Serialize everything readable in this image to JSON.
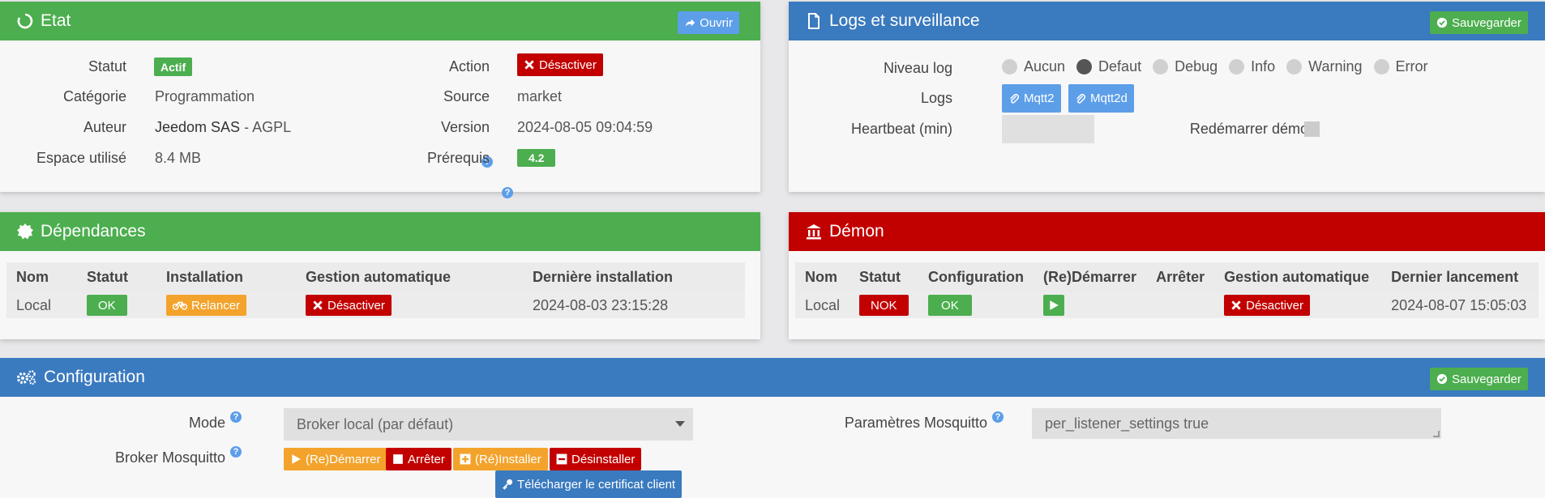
{
  "etat": {
    "title": "Etat",
    "open_label": "Ouvrir",
    "statut_label": "Statut",
    "statut_value": "Actif",
    "categorie_label": "Catégorie",
    "categorie_value": "Programmation",
    "auteur_label": "Auteur",
    "auteur_value": "Jeedom SAS",
    "auteur_license": " - AGPL",
    "espace_label": "Espace utilisé",
    "espace_value": "8.4 MB",
    "action_label": "Action",
    "action_button": "Désactiver",
    "source_label": "Source",
    "source_value": "market",
    "version_label": "Version",
    "version_value": "2024-08-05 09:04:59",
    "prerequis_label": "Prérequis",
    "prerequis_value": "4.2",
    "help_glyph": "?"
  },
  "logs": {
    "title": "Logs et surveillance",
    "save_label": "Sauvegarder",
    "niveau_label": "Niveau log",
    "levels": [
      "Aucun",
      "Defaut",
      "Debug",
      "Info",
      "Warning",
      "Error"
    ],
    "selected_level": "Defaut",
    "logs_label": "Logs",
    "log_buttons": [
      "Mqtt2",
      "Mqtt2d"
    ],
    "heartbeat_label": "Heartbeat (min)",
    "heartbeat_value": "",
    "restart_label": "Redémarrer démon"
  },
  "dependances": {
    "title": "Dépendances",
    "headers": [
      "Nom",
      "Statut",
      "Installation",
      "Gestion automatique",
      "Dernière installation"
    ],
    "row": {
      "nom": "Local",
      "statut": "OK",
      "installation": "Relancer",
      "gestion": "Désactiver",
      "derniere": "2024-08-03 23:15:28"
    }
  },
  "demon": {
    "title": "Démon",
    "headers": [
      "Nom",
      "Statut",
      "Configuration",
      "(Re)Démarrer",
      "Arrêter",
      "Gestion automatique",
      "Dernier lancement"
    ],
    "row": {
      "nom": "Local",
      "statut": "NOK",
      "configuration": "OK",
      "gestion": "Désactiver",
      "dernier": "2024-08-07 15:05:03"
    }
  },
  "configuration": {
    "title": "Configuration",
    "save_label": "Sauvegarder",
    "mode_label": "Mode",
    "mode_value": "Broker local (par défaut)",
    "broker_label": "Broker Mosquitto",
    "broker_buttons": {
      "restart": "(Re)Démarrer",
      "stop": "Arrêter",
      "install": "(Ré)Installer",
      "uninstall": "Désinstaller",
      "download": "Télécharger le certificat client"
    },
    "params_label": "Paramètres Mosquitto",
    "params_value": "per_listener_settings true"
  },
  "colors": {
    "green": "#4cae4f",
    "blue": "#3a7abf",
    "red": "#c10000",
    "orange": "#f3a32c",
    "light_blue": "#5d9ee9"
  }
}
